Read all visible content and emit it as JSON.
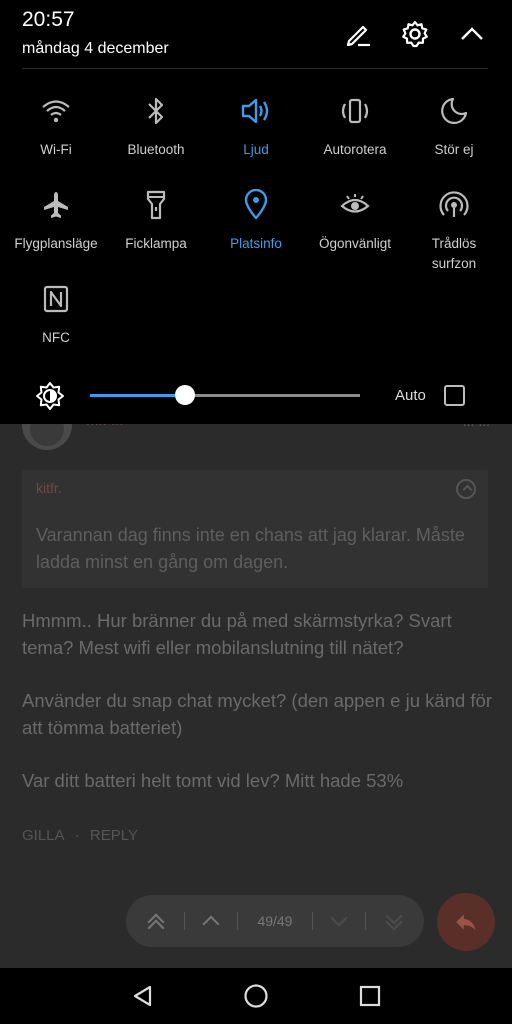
{
  "status": {
    "time": "20:57",
    "date": "måndag 4 december"
  },
  "header_buttons": [
    {
      "name": "edit-icon"
    },
    {
      "name": "gear-icon"
    },
    {
      "name": "collapse-chevron-icon"
    }
  ],
  "tiles": [
    {
      "id": "wifi",
      "label": "Wi-Fi",
      "icon": "wifi-icon",
      "active": false
    },
    {
      "id": "bluetooth",
      "label": "Bluetooth",
      "icon": "bluetooth-icon",
      "active": false
    },
    {
      "id": "sound",
      "label": "Ljud",
      "icon": "speaker-icon",
      "active": true
    },
    {
      "id": "autorotate",
      "label": "Autorotera",
      "icon": "rotate-icon",
      "active": false
    },
    {
      "id": "dnd",
      "label": "Stör ej",
      "icon": "moon-icon",
      "active": false
    },
    {
      "id": "airplane",
      "label": "Flygplansläge",
      "icon": "airplane-icon",
      "active": false
    },
    {
      "id": "flashlight",
      "label": "Ficklampa",
      "icon": "flashlight-icon",
      "active": false
    },
    {
      "id": "location",
      "label": "Platsinfo",
      "icon": "location-pin-icon",
      "active": true
    },
    {
      "id": "eyecomfort",
      "label": "Ögonvänligt",
      "icon": "eye-icon",
      "active": false
    },
    {
      "id": "hotspot",
      "label": "Trådlös\nsurfzon",
      "icon": "hotspot-icon",
      "active": false
    },
    {
      "id": "nfc",
      "label": "NFC",
      "icon": "nfc-icon",
      "active": false
    }
  ],
  "brightness": {
    "level": 0.35,
    "auto_label": "Auto",
    "auto_checked": false
  },
  "background_post": {
    "author": "Mr. ...",
    "meta": "... ...",
    "quote_author": "kitfr.",
    "quote_text": "Varannan dag finns inte en chans att jag klarar. Måste ladda minst en gång om dagen.",
    "paragraphs": [
      "Hmmm.. Hur bränner du på med skärmstyrka? Svart tema? Mest wifi eller mobilanslutning till nätet?",
      "Använder du snap chat mycket? (den appen e ju känd för att tömma batteriet)",
      "Var ditt batteri helt tomt vid lev? Mitt hade 53%"
    ],
    "like_label": "GILLA",
    "dot": "·",
    "reply_label": "REPLY"
  },
  "pager": {
    "count": "49/49"
  },
  "colors": {
    "accent": "#3d9be9",
    "shade_bg": "#000000",
    "fab": "#5a2f27"
  }
}
